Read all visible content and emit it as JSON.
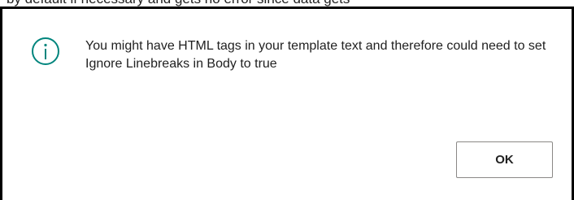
{
  "background": {
    "partial_text": "by default if necessary and gets no error since data gets"
  },
  "dialog": {
    "icon": "info-icon",
    "accent_color": "#00857d",
    "message": "You might have HTML tags in your template text and therefore could need to set Ignore Linebreaks in Body to true",
    "ok_label": "OK"
  }
}
